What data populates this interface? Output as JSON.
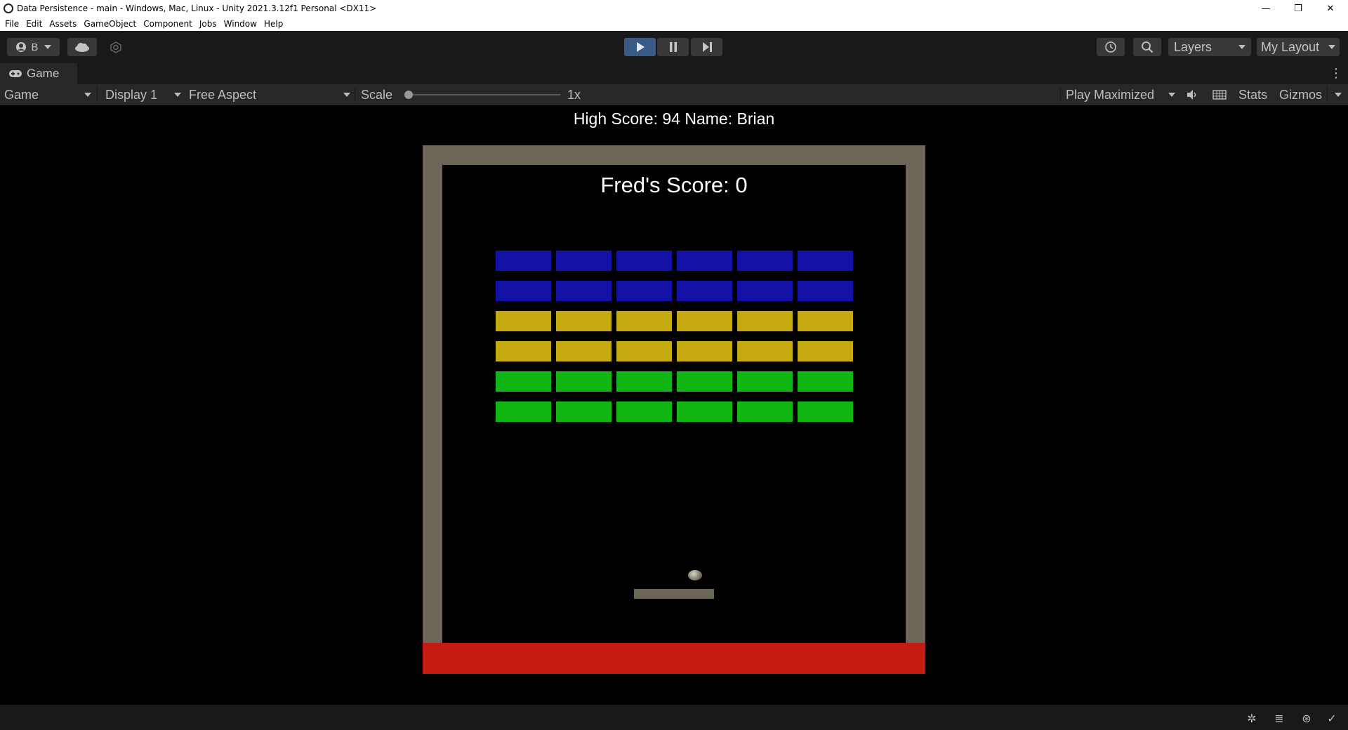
{
  "window": {
    "title": "Data Persistence - main - Windows, Mac, Linux - Unity 2021.3.12f1 Personal <DX11>",
    "minimize": "—",
    "restore": "❐",
    "close": "✕"
  },
  "menu": [
    "File",
    "Edit",
    "Assets",
    "GameObject",
    "Component",
    "Jobs",
    "Window",
    "Help"
  ],
  "toolbar": {
    "account_label": "B",
    "layers_label": "Layers",
    "layout_label": "My Layout"
  },
  "tab": {
    "label": "Game"
  },
  "game_toolbar": {
    "mode": "Game",
    "display": "Display 1",
    "aspect": "Free Aspect",
    "scale_label": "Scale",
    "scale_value": "1x",
    "play_mode": "Play Maximized",
    "stats": "Stats",
    "gizmos": "Gizmos"
  },
  "game": {
    "high_score_text": "High Score: 94 Name: Brian",
    "score_text": "Fred's Score: 0",
    "brick_rows": [
      {
        "color": "#1412a6",
        "count": 6
      },
      {
        "color": "#1412a6",
        "count": 6
      },
      {
        "color": "#c4aa10",
        "count": 6
      },
      {
        "color": "#c4aa10",
        "count": 6
      },
      {
        "color": "#12b612",
        "count": 6
      },
      {
        "color": "#12b612",
        "count": 6
      }
    ],
    "wall_color": "#6b6657",
    "deadzone_color": "#c41a12"
  }
}
